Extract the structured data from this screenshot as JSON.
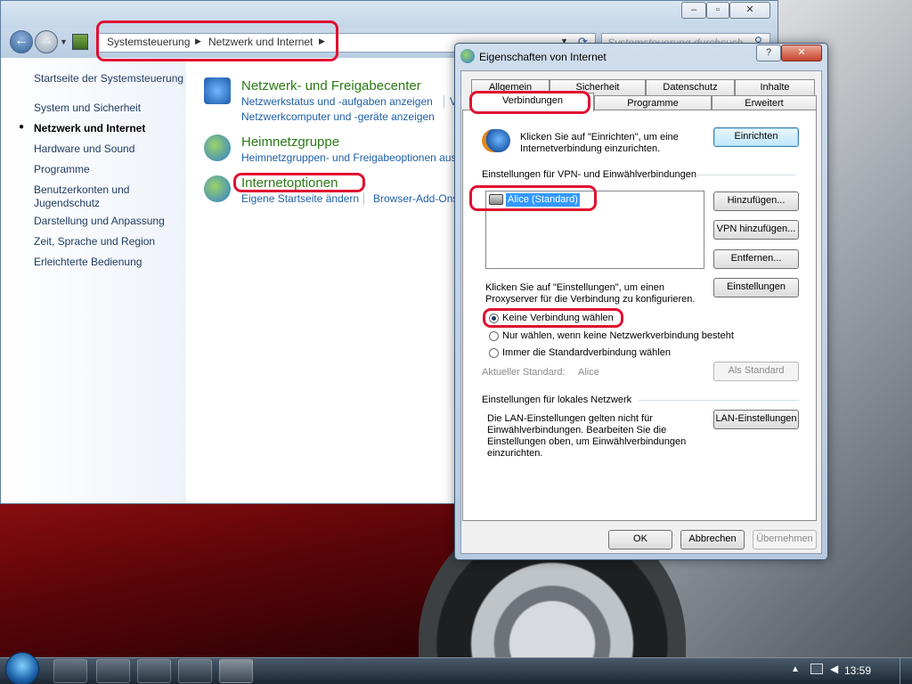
{
  "explorer": {
    "breadcrumb": [
      "Systemsteuerung",
      "Netzwerk und Internet"
    ],
    "search_placeholder": "Systemsteuerung durchsuch",
    "sidebar": [
      "Startseite der Systemsteuerung",
      "System und Sicherheit",
      "Netzwerk und Internet",
      "Hardware und Sound",
      "Programme",
      "Benutzerkonten und",
      "Jugendschutz",
      "Darstellung und Anpassung",
      "Zeit, Sprache und Region",
      "Erleichterte Bedienung"
    ],
    "categories": [
      {
        "title": "Netzwerk- und Freigabecenter",
        "links": [
          "Netzwerkstatus und -aufgaben anzeigen",
          "Netzwerkcomputer und -geräte anzeigen"
        ]
      },
      {
        "title": "Heimnetzgruppe",
        "links": [
          "Heimnetzgruppen- und Freigabeoptionen aus"
        ]
      },
      {
        "title": "Internetoptionen",
        "links": [
          "Eigene Startseite ändern",
          "Browser-Add-Ons"
        ]
      }
    ],
    "cut_link": "V"
  },
  "dialog": {
    "title": "Eigenschaften von Internet",
    "help_glyph": "?",
    "close_glyph": "✕",
    "tabs_row1": [
      "Allgemein",
      "Sicherheit",
      "Datenschutz",
      "Inhalte"
    ],
    "tabs_row2": [
      "Verbindungen",
      "Programme",
      "Erweitert"
    ],
    "setup_text": [
      "Klicken Sie auf \"Einrichten\", um eine",
      "Internetverbindung einzurichten."
    ],
    "setup_button": "Einrichten",
    "vpn_group": "Einstellungen für VPN- und Einwählverbindungen",
    "connections": [
      "Alice (Standard)"
    ],
    "add_button": "Hinzufügen...",
    "add_vpn_button": "VPN hinzufügen...",
    "remove_button": "Entfernen...",
    "settings_text": [
      "Klicken Sie auf \"Einstellungen\", um einen",
      "Proxyserver für die Verbindung zu konfigurieren."
    ],
    "settings_button": "Einstellungen",
    "radios": [
      "Keine Verbindung wählen",
      "Nur wählen, wenn keine Netzwerkverbindung besteht",
      "Immer die Standardverbindung wählen"
    ],
    "current_default_label": "Aktueller Standard:",
    "current_default_value": "Alice",
    "set_default_button": "Als Standard",
    "lan_group": "Einstellungen für lokales Netzwerk",
    "lan_text": [
      "Die LAN-Einstellungen gelten nicht für",
      "Einwählverbindungen. Bearbeiten Sie die",
      "Einstellungen oben, um Einwählverbindungen",
      "einzurichten."
    ],
    "lan_button": "LAN-Einstellungen",
    "ok": "OK",
    "cancel": "Abbrechen",
    "apply": "Übernehmen"
  },
  "taskbar": {
    "clock": "13:59"
  },
  "colors": {
    "highlight": "#e01030",
    "link": "#1e5fa8",
    "category": "#2b7a14"
  }
}
